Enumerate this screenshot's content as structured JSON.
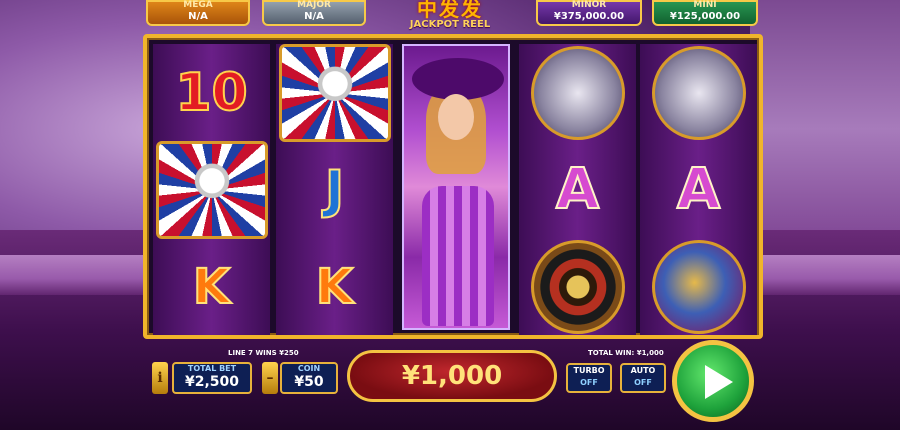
{
  "jackpots": {
    "mega": {
      "name": "MEGA",
      "value": "N/A"
    },
    "major": {
      "name": "MAJOR",
      "value": "N/A"
    },
    "minor": {
      "name": "MINOR",
      "value": "¥375,000.00"
    },
    "mini": {
      "name": "MINI",
      "value": "¥125,000.00"
    }
  },
  "logo": {
    "title": "中发发",
    "subtitle": "JACKPOT REEL"
  },
  "reels": {
    "r1": [
      "10",
      "shield",
      "K"
    ],
    "r2": [
      "shield",
      "J",
      "K"
    ],
    "r3": [
      "lady"
    ],
    "r4": [
      "cards",
      "A",
      "roulette"
    ],
    "r5": [
      "cards",
      "A",
      "dice"
    ]
  },
  "symbols": {
    "ten": "10",
    "j": "J",
    "k": "K",
    "a": "A"
  },
  "panel": {
    "info_icon": "i",
    "total_bet_label": "TOTAL BET",
    "total_bet": "¥2,500",
    "coin_label": "COIN",
    "coin": "¥50",
    "minus": "–",
    "line_wins": "LINE 7 WINS ¥250",
    "win_amount": "¥1,000",
    "total_win": "TOTAL WIN: ¥1,000",
    "turbo_label": "TURBO",
    "turbo_state": "OFF",
    "auto_label": "AUTO",
    "auto_state": "OFF"
  },
  "colors": {
    "gold": "#f0b52b",
    "win_red": "#c0272d",
    "spin_green": "#1ea23b",
    "panel_blue": "#0e1f54"
  }
}
